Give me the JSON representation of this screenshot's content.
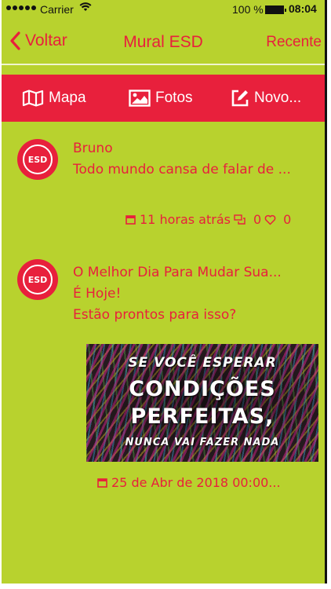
{
  "status_bar": {
    "carrier": "Carrier",
    "battery_percent": "100 %",
    "time": "08:04"
  },
  "nav": {
    "back_label": "Voltar",
    "title": "Mural ESD",
    "right_label": "Recente"
  },
  "toolbar": {
    "items": [
      {
        "label": "Mapa",
        "icon": "map-icon"
      },
      {
        "label": "Fotos",
        "icon": "photo-icon"
      },
      {
        "label": "Novo...",
        "icon": "edit-icon"
      }
    ]
  },
  "colors": {
    "background": "#b8d22e",
    "accent": "#e8203c",
    "toolbar_text": "#ffffff"
  },
  "posts": [
    {
      "avatar_text": "ESD",
      "lines": [
        "Bruno",
        "Todo mundo cansa de falar de ..."
      ],
      "time": "11 horas atrás",
      "comments": "0",
      "likes": "0"
    },
    {
      "avatar_text": "ESD",
      "lines": [
        "O Melhor Dia Para Mudar Sua...",
        "É Hoje!",
        "Estão prontos para isso?"
      ],
      "image_text": [
        "SE VOCÊ ESPERAR",
        "CONDIÇÕES",
        "PERFEITAS,",
        "NUNCA VAI FAZER NADA"
      ],
      "time": "25 de Abr de 2018 00:00..."
    }
  ]
}
